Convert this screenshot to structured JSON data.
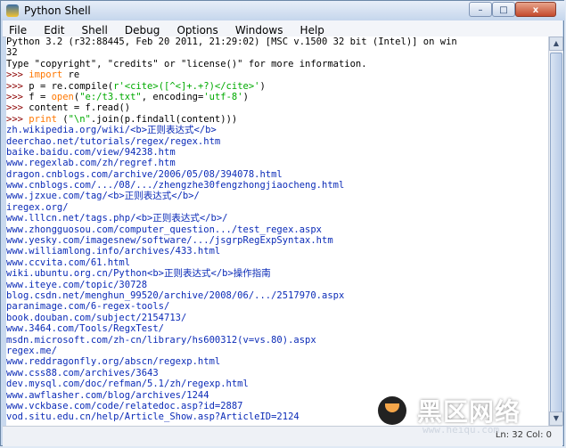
{
  "window": {
    "title": "Python Shell",
    "controls": {
      "minimize": "–",
      "maximize": "□",
      "close": "x"
    }
  },
  "menu": [
    "File",
    "Edit",
    "Shell",
    "Debug",
    "Options",
    "Windows",
    "Help"
  ],
  "console": {
    "banner_line1": "Python 3.2 (r32:88445, Feb 20 2011, 21:29:02) [MSC v.1500 32 bit (Intel)] on win",
    "banner_line2": "32",
    "banner_line3": "Type \"copyright\", \"credits\" or \"license()\" for more information.",
    "commands": [
      [
        "import",
        " re"
      ],
      [
        "p = re.compile(",
        "r'<cite>([^<]+.+?)</cite>'",
        ")"
      ],
      [
        "f = ",
        "open",
        "(",
        "\"e:/t3.txt\"",
        ", encoding=",
        "'utf-8'",
        ")"
      ],
      [
        "content = f.read()"
      ],
      [
        "print",
        " (",
        "\"\\n\"",
        ".join(p.findall(content)))"
      ]
    ],
    "prompt": ">>> ",
    "output": [
      "zh.wikipedia.org/wiki/<b>正则表达式</b>",
      "deerchao.net/tutorials/regex/regex.htm",
      "baike.baidu.com/view/94238.htm",
      "www.regexlab.com/zh/regref.htm",
      "dragon.cnblogs.com/archive/2006/05/08/394078.html",
      "www.cnblogs.com/.../08/.../zhengzhe30fengzhongjiaocheng.html",
      "www.jzxue.com/tag/<b>正则表达式</b>/",
      "iregex.org/",
      "www.lllcn.net/tags.php/<b>正则表达式</b>/",
      "www.zhongguosou.com/computer_question.../test_regex.aspx",
      "www.yesky.com/imagesnew/software/.../jsgrpRegExpSyntax.htm",
      "www.williamlong.info/archives/433.html",
      "www.ccvita.com/61.html",
      "wiki.ubuntu.org.cn/Python<b>正则表达式</b>操作指南",
      "www.iteye.com/topic/30728",
      "blog.csdn.net/menghun_99520/archive/2008/06/.../2517970.aspx",
      "paranimage.com/6-regex-tools/",
      "book.douban.com/subject/2154713/",
      "www.3464.com/Tools/RegxTest/",
      "msdn.microsoft.com/zh-cn/library/hs600312(v=vs.80).aspx",
      "regex.me/",
      "www.reddragonfly.org/abscn/regexp.html",
      "www.css88.com/archives/3643",
      "dev.mysql.com/doc/refman/5.1/zh/regexp.html",
      "www.awflasher.com/blog/archives/1244",
      "www.vckbase.com/code/relatedoc.asp?id=2887",
      "vod.situ.edu.cn/help/Article_Show.asp?ArticleID=2124"
    ]
  },
  "status": {
    "position": "Ln: 32 Col: 0"
  },
  "watermark": {
    "text": "黑区网络",
    "sub": "www.heiqu.com"
  },
  "colors": {
    "url": "#0b2bb7",
    "keyword": "#ff7700",
    "string": "#00aa00",
    "prompt": "#8b0000"
  }
}
